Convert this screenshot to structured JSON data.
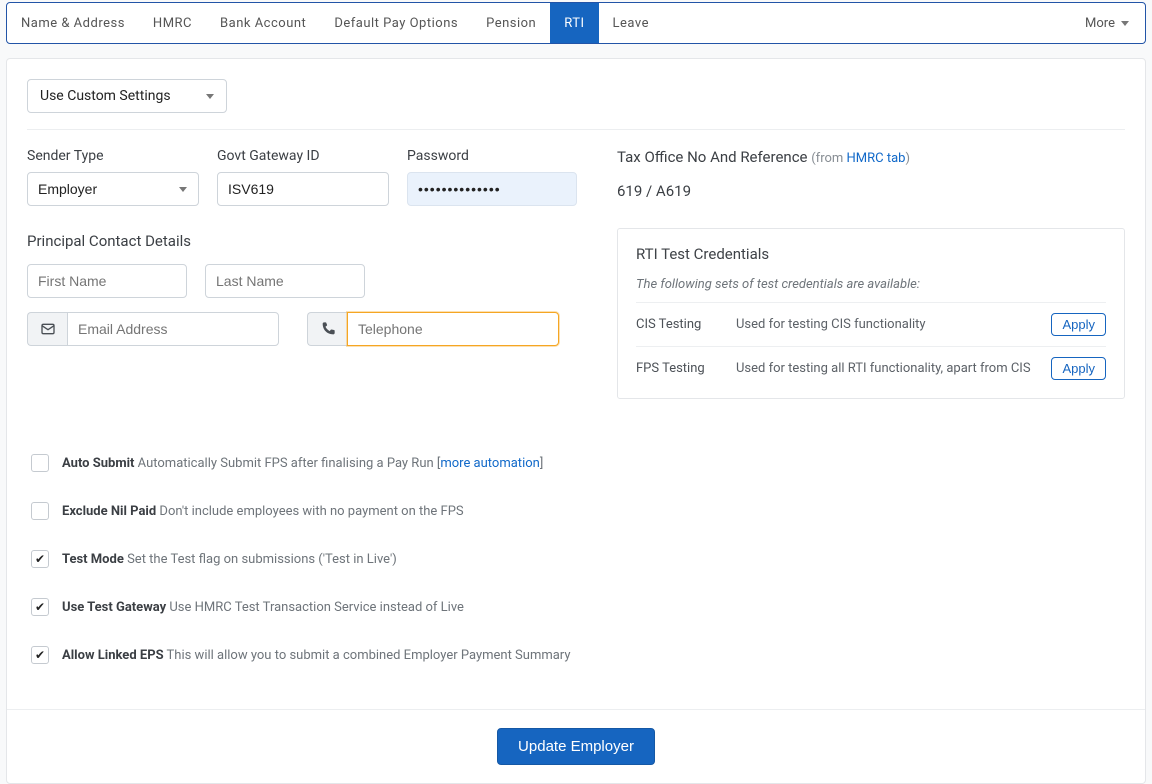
{
  "tabs": {
    "items": [
      "Name & Address",
      "HMRC",
      "Bank Account",
      "Default Pay Options",
      "Pension",
      "RTI",
      "Leave"
    ],
    "active_index": 5,
    "more_label": "More"
  },
  "dropdown": {
    "settings_label": "Use Custom Settings"
  },
  "sender_type": {
    "label": "Sender Type",
    "value": "Employer",
    "options": [
      "Employer"
    ]
  },
  "gateway_id": {
    "label": "Govt Gateway ID",
    "value": "ISV619"
  },
  "password": {
    "label": "Password",
    "value": "••••••••••••••"
  },
  "tax_ref": {
    "label": "Tax Office No And Reference",
    "from_prefix": "(from ",
    "link_text": "HMRC tab",
    "from_suffix": ")",
    "value": "619 / A619"
  },
  "contact": {
    "title": "Principal Contact Details",
    "first_name_placeholder": "First Name",
    "last_name_placeholder": "Last Name",
    "email_placeholder": "Email Address",
    "phone_placeholder": "Telephone"
  },
  "credentials": {
    "title": "RTI Test Credentials",
    "subtitle": "The following sets of test credentials are available:",
    "apply_label": "Apply",
    "rows": [
      {
        "name": "CIS Testing",
        "desc": "Used for testing CIS functionality"
      },
      {
        "name": "FPS Testing",
        "desc": "Used for testing all RTI functionality, apart from CIS"
      }
    ]
  },
  "checks": {
    "auto_submit": {
      "checked": false,
      "strong": "Auto Submit",
      "text": " Automatically Submit FPS after finalising a Pay Run [",
      "link": "more automation",
      "tail": "]"
    },
    "exclude_nil": {
      "checked": false,
      "strong": "Exclude Nil Paid",
      "text": " Don't include employees with no payment on the FPS"
    },
    "test_mode": {
      "checked": true,
      "strong": "Test Mode",
      "text": " Set the Test flag on submissions ('Test in Live')"
    },
    "use_gateway": {
      "checked": true,
      "strong": "Use Test Gateway",
      "text": " Use HMRC Test Transaction Service instead of Live"
    },
    "allow_linked": {
      "checked": true,
      "strong": "Allow Linked EPS",
      "text": " This will allow you to submit a combined Employer Payment Summary"
    }
  },
  "footer": {
    "button": "Update Employer"
  }
}
